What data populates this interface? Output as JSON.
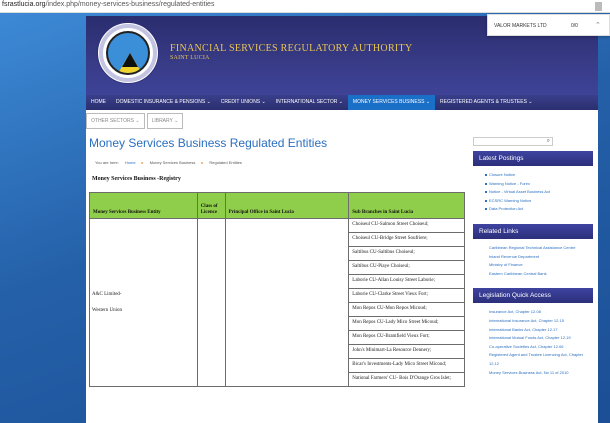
{
  "browser": {
    "url_host": "fsrastlucia.org",
    "url_path": "/index.php/money-services-business/regulated-entities"
  },
  "popup": {
    "name": "VALOR MARKETS LTD",
    "count": "0/0"
  },
  "brand": {
    "title": "FINANCIAL SERVICES  REGULATORY AUTHORITY",
    "subtitle": "SAINT LUCIA",
    "seal_text": "FINANCIAL SERVICES REGULATORY AUTHORITY SAINT LUCIA"
  },
  "nav": {
    "items": [
      {
        "label": "HOME"
      },
      {
        "label": "DOMESTIC INSURANCE & PENSIONS"
      },
      {
        "label": "CREDIT UNIONS"
      },
      {
        "label": "INTERNATIONAL SECTOR"
      },
      {
        "label": "MONEY SERVICES BUSINESS"
      },
      {
        "label": "REGISTERED AGENTS & TRUSTEES"
      }
    ],
    "active_index": 4
  },
  "subnav": {
    "items": [
      {
        "label": "OTHER SECTORS"
      },
      {
        "label": "LIBRARY"
      }
    ]
  },
  "page": {
    "title": "Money Services Business Regulated Entities",
    "breadcrumb": {
      "prefix": "You are here:",
      "home": "Home",
      "section": "Money Services Business",
      "current": "Regulated Entities"
    },
    "registry_heading": "Money Services Business -Registry"
  },
  "table": {
    "headers": [
      "Money Services Business Entity",
      "Class of Licence",
      "Principal Office in Saint Lucia",
      "Sub Branches in Saint Lucia"
    ],
    "rows": [
      {
        "entity_lines": [
          "A&C Limited-",
          "Western Union"
        ],
        "class": "",
        "principal_office": "",
        "branches": [
          "Choiseul CU-Salmon Street Choiseul;",
          "Choiseul CU-Bridge Street Soufriere;",
          "Saltibus CU-Saltibus Choiseul;",
          "Saltibus CU-Piaye Choiseul;",
          "Laborie CU-Allan Louisy Street Laborie;",
          "Laborie CU-Clarke Street Vieux Fort;",
          "Mon Repos CU-Mon Repos Micoud;",
          "Mon Repos CU-Lady Mico Street Micoud;",
          "Mon Repos CU-Bramfield Vieux Fort;",
          "John's Minimart-La Resource Dennery;",
          "Bicar's Investments-Lady Mico Street Micoud;",
          "National Farmers' CU- Bois D'Orange Gros Islet;"
        ]
      }
    ]
  },
  "sidebar": {
    "search_icon": "search-icon",
    "latest_postings": {
      "title": "Latest Postings",
      "items": [
        "Closure Notice",
        "Warning Notice - Forex",
        "Notice - Virtual Asset Business Act",
        "ECSRC Warning Notice",
        "Data Protection Act"
      ]
    },
    "related_links": {
      "title": "Related Links",
      "items": [
        "Caribbean Regional Technical Assistance Centre",
        "Inland Revenue Department",
        "Ministry of Finance",
        "Eastern Caribbean Central Bank"
      ]
    },
    "legislation": {
      "title": "Legislation Quick Access",
      "items": [
        "Insurance Act, Chapter 12.08",
        "International Insurance Act, Chapter 12.15",
        "International Banks Act, Chapter 12.17",
        "International Mutual Funds Act, Chapter 12.19",
        "Co-operative Societies Act, Chapter 12.06",
        "Registered Agent and Trustee Licencing Act, Chapter 12.12",
        "Money Services Business Act, No 11 of 2010"
      ]
    }
  },
  "colors": {
    "accent": "#2a6fc0",
    "header_bg": "#2f3278",
    "table_header": "#8fce4a",
    "brand_gold": "#e8c556"
  }
}
